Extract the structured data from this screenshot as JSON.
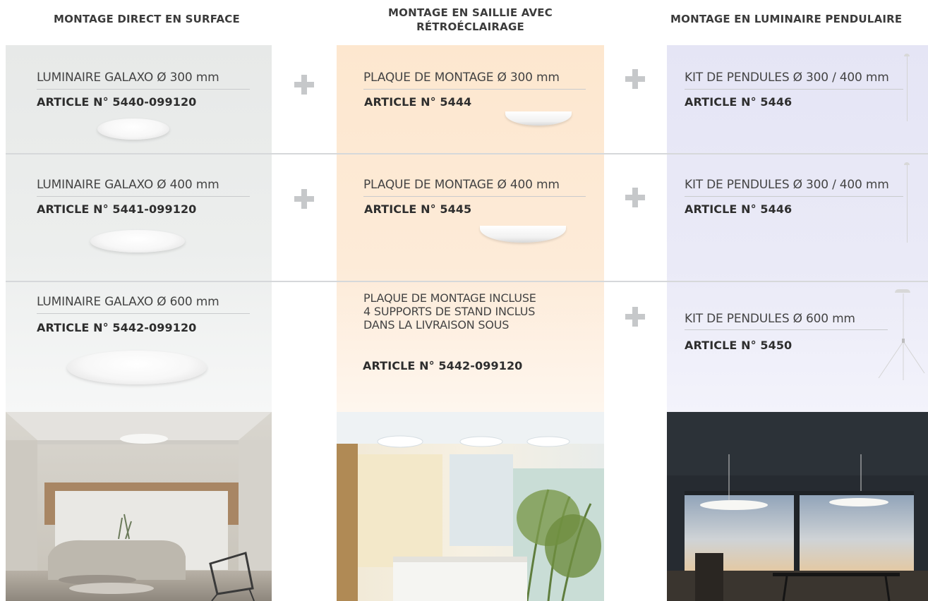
{
  "columns": [
    {
      "header": "MONTAGE DIRECT EN SURFACE",
      "rows": [
        {
          "title": "LUMINAIRE GALAXO Ø 300 mm",
          "article": "ARTICLE N° 5440-099120"
        },
        {
          "title": "LUMINAIRE GALAXO Ø 400 mm",
          "article": "ARTICLE N° 5441-099120"
        },
        {
          "title": "LUMINAIRE GALAXO Ø 600 mm",
          "article": "ARTICLE N° 5442-099120"
        }
      ]
    },
    {
      "header_line1": "MONTAGE EN SAILLIE AVEC",
      "header_line2": "RÉTROÉCLAIRAGE",
      "rows": [
        {
          "title": "PLAQUE DE MONTAGE  Ø 300 mm",
          "article": "ARTICLE N° 5444"
        },
        {
          "title": "PLAQUE DE MONTAGE  Ø 400 mm",
          "article": "ARTICLE N° 5445"
        },
        {
          "title_lines": [
            "PLAQUE DE MONTAGE INCLUSE",
            "4 SUPPORTS DE STAND INCLUS",
            "DANS LA LIVRAISON SOUS"
          ],
          "article": "ARTICLE N° 5442-099120"
        }
      ]
    },
    {
      "header": "MONTAGE EN LUMINAIRE PENDULAIRE",
      "rows": [
        {
          "title": "KIT DE PENDULES Ø 300 / 400 mm",
          "article": "ARTICLE N° 5446"
        },
        {
          "title": "KIT DE PENDULES Ø 300 / 400 mm",
          "article": "ARTICLE N° 5446"
        },
        {
          "title": "KIT DE PENDULES Ø 600 mm",
          "article": "ARTICLE N° 5450"
        }
      ]
    }
  ],
  "colors": {
    "panel_gray": "#e9ebea",
    "panel_peach": "#fde8d2",
    "panel_lavender": "#e8e8f6",
    "plus_sign": "#c6c8ca",
    "divider": "#d6d8da"
  },
  "icons": [
    "plus-icon"
  ]
}
